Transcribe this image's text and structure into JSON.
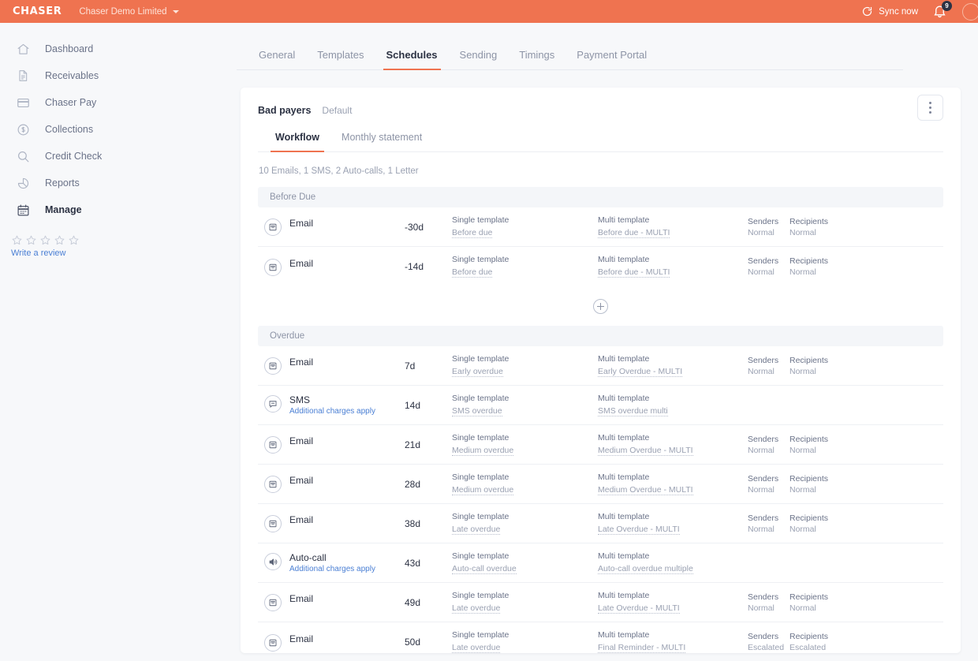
{
  "topbar": {
    "brand": "CHASER",
    "org": "Chaser Demo Limited",
    "sync_label": "Sync now",
    "notification_count": "9",
    "accent_color": "#ef7350"
  },
  "sidebar": {
    "items": [
      {
        "label": "Dashboard",
        "icon": "home-icon",
        "active": false
      },
      {
        "label": "Receivables",
        "icon": "document-icon",
        "active": false
      },
      {
        "label": "Chaser Pay",
        "icon": "card-icon",
        "active": false
      },
      {
        "label": "Collections",
        "icon": "dollar-circle-icon",
        "active": false
      },
      {
        "label": "Credit Check",
        "icon": "search-icon",
        "active": false
      },
      {
        "label": "Reports",
        "icon": "pie-chart-icon",
        "active": false
      },
      {
        "label": "Manage",
        "icon": "calendar-icon",
        "active": true
      }
    ],
    "review": {
      "stars": 5,
      "link_label": "Write a review"
    }
  },
  "tabs": [
    {
      "label": "General",
      "active": false
    },
    {
      "label": "Templates",
      "active": false
    },
    {
      "label": "Schedules",
      "active": true
    },
    {
      "label": "Sending",
      "active": false
    },
    {
      "label": "Timings",
      "active": false
    },
    {
      "label": "Payment Portal",
      "active": false
    }
  ],
  "schedule": {
    "name": "Bad payers",
    "default_badge": "Default",
    "subtabs": [
      {
        "label": "Workflow",
        "active": true
      },
      {
        "label": "Monthly statement",
        "active": false
      }
    ],
    "summary": "10 Emails, 1 SMS, 2 Auto-calls, 1 Letter",
    "sections": [
      {
        "title": "Before Due",
        "has_add_button": true,
        "rows": [
          {
            "type": "Email",
            "icon": "envelope-icon",
            "charges_note": "",
            "days": "-30d",
            "single_label": "Single template",
            "single_value": "Before due",
            "multi_label": "Multi template",
            "multi_value": "Before due - MULTI",
            "senders_label": "Senders",
            "senders_value": "Normal",
            "recipients_label": "Recipients",
            "recipients_value": "Normal"
          },
          {
            "type": "Email",
            "icon": "envelope-icon",
            "charges_note": "",
            "days": "-14d",
            "single_label": "Single template",
            "single_value": "Before due",
            "multi_label": "Multi template",
            "multi_value": "Before due - MULTI",
            "senders_label": "Senders",
            "senders_value": "Normal",
            "recipients_label": "Recipients",
            "recipients_value": "Normal"
          }
        ]
      },
      {
        "title": "Overdue",
        "has_add_button": false,
        "rows": [
          {
            "type": "Email",
            "icon": "envelope-icon",
            "charges_note": "",
            "days": "7d",
            "single_label": "Single template",
            "single_value": "Early overdue",
            "multi_label": "Multi template",
            "multi_value": "Early Overdue - MULTI",
            "senders_label": "Senders",
            "senders_value": "Normal",
            "recipients_label": "Recipients",
            "recipients_value": "Normal"
          },
          {
            "type": "SMS",
            "icon": "speech-bubble-icon",
            "charges_note": "Additional charges apply",
            "days": "14d",
            "single_label": "Single template",
            "single_value": "SMS overdue",
            "multi_label": "Multi template",
            "multi_value": "SMS overdue multi",
            "senders_label": "",
            "senders_value": "",
            "recipients_label": "",
            "recipients_value": ""
          },
          {
            "type": "Email",
            "icon": "envelope-icon",
            "charges_note": "",
            "days": "21d",
            "single_label": "Single template",
            "single_value": "Medium overdue",
            "multi_label": "Multi template",
            "multi_value": "Medium Overdue - MULTI",
            "senders_label": "Senders",
            "senders_value": "Normal",
            "recipients_label": "Recipients",
            "recipients_value": "Normal"
          },
          {
            "type": "Email",
            "icon": "envelope-icon",
            "charges_note": "",
            "days": "28d",
            "single_label": "Single template",
            "single_value": "Medium overdue",
            "multi_label": "Multi template",
            "multi_value": "Medium Overdue - MULTI",
            "senders_label": "Senders",
            "senders_value": "Normal",
            "recipients_label": "Recipients",
            "recipients_value": "Normal"
          },
          {
            "type": "Email",
            "icon": "envelope-icon",
            "charges_note": "",
            "days": "38d",
            "single_label": "Single template",
            "single_value": "Late overdue",
            "multi_label": "Multi template",
            "multi_value": "Late Overdue - MULTI",
            "senders_label": "Senders",
            "senders_value": "Normal",
            "recipients_label": "Recipients",
            "recipients_value": "Normal"
          },
          {
            "type": "Auto-call",
            "icon": "speaker-icon",
            "charges_note": "Additional charges apply",
            "days": "43d",
            "single_label": "Single template",
            "single_value": "Auto-call overdue",
            "multi_label": "Multi template",
            "multi_value": "Auto-call overdue multiple",
            "senders_label": "",
            "senders_value": "",
            "recipients_label": "",
            "recipients_value": ""
          },
          {
            "type": "Email",
            "icon": "envelope-icon",
            "charges_note": "",
            "days": "49d",
            "single_label": "Single template",
            "single_value": "Late overdue",
            "multi_label": "Multi template",
            "multi_value": "Late Overdue - MULTI",
            "senders_label": "Senders",
            "senders_value": "Normal",
            "recipients_label": "Recipients",
            "recipients_value": "Normal"
          },
          {
            "type": "Email",
            "icon": "envelope-icon",
            "charges_note": "",
            "days": "50d",
            "single_label": "Single template",
            "single_value": "Late overdue",
            "multi_label": "Multi template",
            "multi_value": "Final Reminder - MULTI",
            "senders_label": "Senders",
            "senders_value": "Escalated",
            "recipients_label": "Recipients",
            "recipients_value": "Escalated"
          }
        ]
      }
    ]
  }
}
